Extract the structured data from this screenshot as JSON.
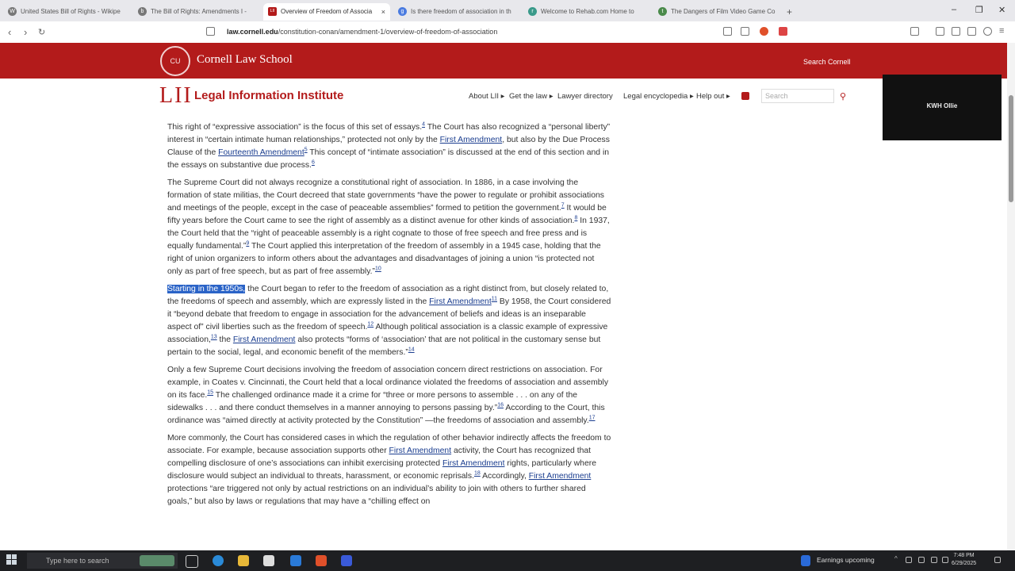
{
  "browser": {
    "tabs": [
      {
        "label": "United States Bill of Rights - Wikipe",
        "favicon": "W"
      },
      {
        "label": "The Bill of Rights: Amendments I - ",
        "favicon": "b"
      },
      {
        "label": "Overview of Freedom of Associa",
        "favicon": "LII"
      },
      {
        "label": "Is there freedom of association in th",
        "favicon": "g"
      },
      {
        "label": "Welcome to Rehab.com Home to",
        "favicon": "r"
      },
      {
        "label": "The Dangers of Film Video Game Co",
        "favicon": "t"
      }
    ],
    "new_tab": "+",
    "close_tab": "×",
    "url_host": "law.cornell.edu",
    "url_path": "/constitution-conan/amendment-1/overview-of-freedom-of-association"
  },
  "cornell": {
    "seal_text": "CU",
    "name": "Cornell Law School",
    "search_label": "Search Cornell"
  },
  "lii": {
    "logo": "LII",
    "name": "Legal Information Institute",
    "nav": [
      "About LII ▸",
      "Get the law ▸",
      "Lawyer directory",
      "Legal encyclopedia ▸",
      "Help out ▸"
    ],
    "search_placeholder": "Search"
  },
  "overlay": {
    "label": "KWH Ollie"
  },
  "article": {
    "p1": {
      "t1": "This right of “expressive association” is the focus of this set of essays.",
      "s1": "4",
      "t2": " The Court has also recognized a “personal liberty” interest in “certain intimate human relationships,” protected not only by the ",
      "l1": "First Amendment",
      "t3": ", but also by the Due Process Clause of the ",
      "l2": "Fourteenth Amendment",
      "s2": "5",
      "t4": " This concept of “intimate association” is discussed at the end of this section and in the essays on substantive due process.",
      "s3": "6"
    },
    "p2": {
      "t1": "The Supreme Court did not always recognize a constitutional right of association. In 1886, in a case involving the formation of state militias, the Court decreed that state governments “have the power to regulate or prohibit associations and meetings of the people, except in the case of peaceable assemblies” formed to petition the government.",
      "s1": "7",
      "t2": " It would be fifty years before the Court came to see the right of assembly as a distinct avenue for other kinds of association.",
      "s2": "8",
      "t3": " In 1937, the Court held that the “right of peaceable assembly is a right cognate to those of free speech and free press and is equally fundamental.”",
      "s3": "9",
      "t4": " The Court applied this interpretation of the freedom of assembly in a 1945 case, holding that the right of union organizers to inform others about the advantages and disadvantages of joining a union “is protected not only as part of free speech, but as part of free assembly.”",
      "s4": "10"
    },
    "p3": {
      "hl": "Starting in the 1950s,",
      "t1": " the Court began to refer to the freedom of association as a right distinct from, but closely related to, the freedoms of speech and assembly, which are expressly listed in the ",
      "l1": "First Amendment",
      "s1": "11",
      "t2": " By 1958, the Court considered it “beyond debate that freedom to engage in association for the advancement of beliefs and ideas is an inseparable aspect of” civil liberties such as the freedom of speech.",
      "s2": "12",
      "t3": " Although political association is a classic example of expressive association,",
      "s3": "13",
      "t4": " the ",
      "l2": "First Amendment",
      "t5": " also protects “forms of ‘association’ that are not political in the customary sense but pertain to the social, legal, and economic benefit of the members.”",
      "s4": "14"
    },
    "p4": {
      "t1": "Only a few Supreme Court decisions involving the freedom of association concern direct restrictions on association. For example, in Coates v. Cincinnati, the Court held that a local ordinance violated the freedoms of association and assembly on its face.",
      "s1": "15",
      "t2": " The challenged ordinance made it a crime for “three or more persons to assemble . . . on any of the sidewalks . . . and there conduct themselves in a manner annoying to persons passing by.”",
      "s2": "16",
      "t3": " According to the Court, this ordinance was “aimed directly at activity protected by the Constitution” —the freedoms of association and assembly.",
      "s3": "17"
    },
    "p5": {
      "t1": "More commonly, the Court has considered cases in which the regulation of other behavior indirectly affects the freedom to associate. For example, because association supports other ",
      "l1": "First Amendment",
      "t2": " activity, the Court has recognized that compelling disclosure of one’s associations can inhibit exercising protected ",
      "l2": "First Amendment",
      "t3": " rights, particularly where disclosure would subject an individual to threats, harassment, or economic reprisals.",
      "s1": "18",
      "t4": " Accordingly, ",
      "l3": "First Amendment",
      "t5": " protections “are triggered not only by actual restrictions on an individual’s ability to join with others to further shared goals,” but also by laws or regulations that may have a “chilling effect on"
    }
  },
  "taskbar": {
    "search_placeholder": "Type here to search",
    "weather": "Earnings upcoming",
    "time": "7:48 PM",
    "date": "6/29/2025"
  },
  "colors": {
    "brand_red": "#b31b1b",
    "link": "#1a3d8f",
    "selection": "#2a63c7"
  }
}
